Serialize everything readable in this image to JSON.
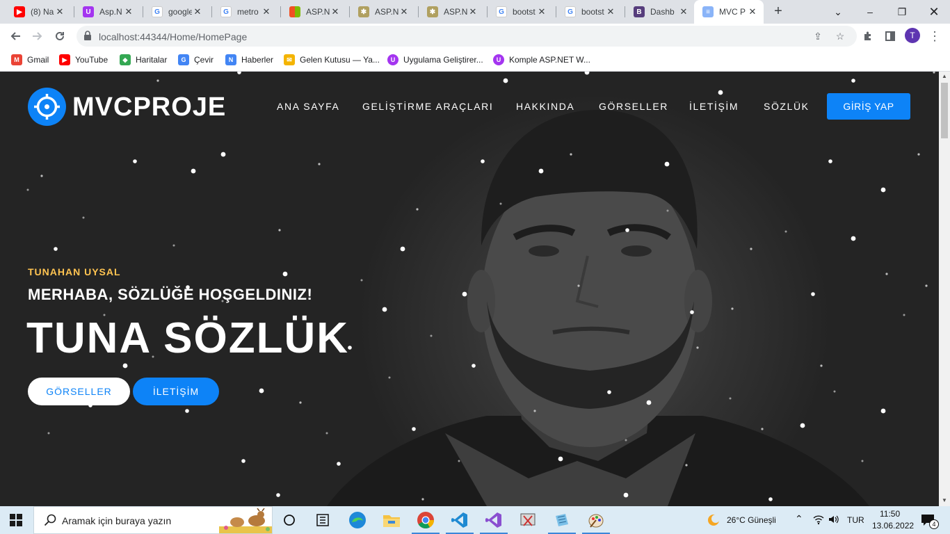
{
  "browser": {
    "tabs": [
      {
        "title": "(8) Na",
        "icon": "youtube-icon",
        "color": "#ff0000"
      },
      {
        "title": "Asp.N",
        "icon": "udemy-icon",
        "color": "#a435f0"
      },
      {
        "title": "google",
        "icon": "google-icon",
        "color": "#4285f4"
      },
      {
        "title": "metro",
        "icon": "google-icon",
        "color": "#4285f4"
      },
      {
        "title": "ASP.N",
        "icon": "microsoft-icon",
        "color": "#f25022"
      },
      {
        "title": "ASP.N",
        "icon": "dotnet-icon",
        "color": "#b0a060"
      },
      {
        "title": "ASP.N",
        "icon": "dotnet-icon",
        "color": "#b0a060"
      },
      {
        "title": "bootst",
        "icon": "google-icon",
        "color": "#4285f4"
      },
      {
        "title": "bootst",
        "icon": "google-icon",
        "color": "#4285f4"
      },
      {
        "title": "Dashb",
        "icon": "bootstrap-icon",
        "color": "#563d7c"
      },
      {
        "title": "MVC P",
        "icon": "page-icon",
        "color": "#8ab4f8"
      }
    ],
    "url": "localhost:44344/Home/HomePage",
    "profile_initial": "T",
    "bookmarks": [
      {
        "label": "Gmail",
        "icon": "gmail-icon",
        "color": "#ea4335"
      },
      {
        "label": "YouTube",
        "icon": "youtube-icon",
        "color": "#ff0000"
      },
      {
        "label": "Haritalar",
        "icon": "maps-icon",
        "color": "#34a853"
      },
      {
        "label": "Çevir",
        "icon": "translate-icon",
        "color": "#4285f4"
      },
      {
        "label": "Haberler",
        "icon": "news-icon",
        "color": "#4285f4"
      },
      {
        "label": "Gelen Kutusu — Ya...",
        "icon": "mail-icon",
        "color": "#f4b400"
      },
      {
        "label": "Uygulama Geliştirer...",
        "icon": "udemy-icon",
        "color": "#a435f0"
      },
      {
        "label": "Komple ASP.NET W...",
        "icon": "udemy-icon",
        "color": "#a435f0"
      }
    ]
  },
  "site": {
    "logo": "MVCPROJE",
    "nav": [
      "ANA SAYFA",
      "GELİŞTİRME ARAÇLARI",
      "HAKKINDA",
      "GÖRSELLER",
      "İLETİŞİM",
      "SÖZLÜK"
    ],
    "login_label": "GİRİŞ YAP",
    "subtitle": "TUNAHAN UYSAL",
    "welcome": "MERHABA, SÖZLÜĞE HOŞGELDINIZ!",
    "headline": "TUNA SÖZLÜK",
    "btn_gallery": "GÖRSELLER",
    "btn_contact": "İLETİŞİM",
    "accent": "#0d83f7",
    "subtitle_color": "#ffc451"
  },
  "taskbar": {
    "search_placeholder": "Aramak için buraya yazın",
    "weather": "26°C  Güneşli",
    "lang": "TUR",
    "time": "11:50",
    "date": "13.06.2022",
    "notification_count": "4"
  }
}
